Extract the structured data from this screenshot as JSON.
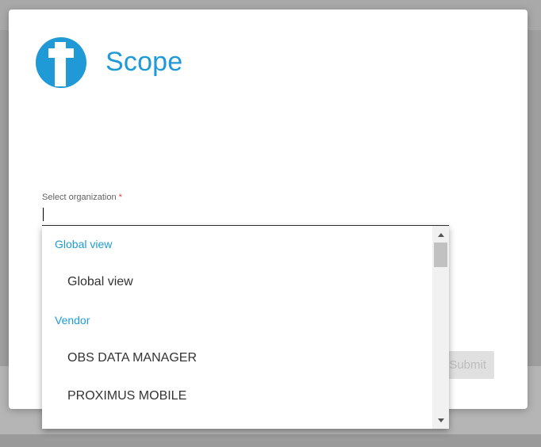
{
  "modal": {
    "title": "Scope",
    "brand_color": "#1f9ad6",
    "logo_icon": "cross-logo-icon",
    "field": {
      "label": "Select organization",
      "required_marker": "*",
      "value": ""
    },
    "submit_label": "Submit"
  },
  "dropdown": {
    "groups": [
      {
        "label": "Global view",
        "items": [
          "Global view"
        ]
      },
      {
        "label": "Vendor",
        "items": [
          "OBS DATA MANAGER",
          "PROXIMUS MOBILE"
        ]
      }
    ],
    "scrollbar": {
      "up_icon": "arrow-up-icon",
      "down_icon": "arrow-down-icon"
    }
  }
}
